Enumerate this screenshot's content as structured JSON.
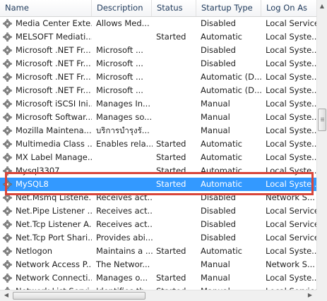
{
  "columns": {
    "name": "Name",
    "description": "Description",
    "status": "Status",
    "startup_type": "Startup Type",
    "log_on_as": "Log On As"
  },
  "rows": [
    {
      "name": "Media Center Exte...",
      "description": "Allows Med...",
      "status": "",
      "startup_type": "Disabled",
      "log_on_as": "Local Service"
    },
    {
      "name": "MELSOFT Mediati...",
      "description": "",
      "status": "Started",
      "startup_type": "Automatic",
      "log_on_as": "Local Syste..."
    },
    {
      "name": "Microsoft .NET Fr...",
      "description": "Microsoft ...",
      "status": "",
      "startup_type": "Disabled",
      "log_on_as": "Local Syste..."
    },
    {
      "name": "Microsoft .NET Fr...",
      "description": "Microsoft ...",
      "status": "",
      "startup_type": "Disabled",
      "log_on_as": "Local Syste..."
    },
    {
      "name": "Microsoft .NET Fr...",
      "description": "Microsoft ...",
      "status": "",
      "startup_type": "Automatic (D...",
      "log_on_as": "Local Syste..."
    },
    {
      "name": "Microsoft .NET Fr...",
      "description": "Microsoft ...",
      "status": "",
      "startup_type": "Automatic (D...",
      "log_on_as": "Local Syste..."
    },
    {
      "name": "Microsoft iSCSI Ini...",
      "description": "Manages In...",
      "status": "",
      "startup_type": "Manual",
      "log_on_as": "Local Syste..."
    },
    {
      "name": "Microsoft Softwar...",
      "description": "Manages so...",
      "status": "",
      "startup_type": "Manual",
      "log_on_as": "Local Syste..."
    },
    {
      "name": "Mozilla Maintena...",
      "description": "บริการบำรุงรั...",
      "status": "",
      "startup_type": "Manual",
      "log_on_as": "Local Syste..."
    },
    {
      "name": "Multimedia Class ...",
      "description": "Enables rela...",
      "status": "Started",
      "startup_type": "Automatic",
      "log_on_as": "Local Syste..."
    },
    {
      "name": "MX Label Manage...",
      "description": "",
      "status": "Started",
      "startup_type": "Automatic",
      "log_on_as": "Local Syste..."
    },
    {
      "name": "Mysql3307",
      "description": "",
      "status": "Started",
      "startup_type": "Automatic",
      "log_on_as": "Local Syste..."
    },
    {
      "name": "MySQL8",
      "description": "",
      "status": "Started",
      "startup_type": "Automatic",
      "log_on_as": "Local Syste...",
      "selected": true
    },
    {
      "name": "Net.Msmq Listene...",
      "description": "Receives act...",
      "status": "",
      "startup_type": "Disabled",
      "log_on_as": "Network S..."
    },
    {
      "name": "Net.Pipe Listener ...",
      "description": "Receives act...",
      "status": "",
      "startup_type": "Disabled",
      "log_on_as": "Local Service"
    },
    {
      "name": "Net.Tcp Listener A...",
      "description": "Receives act...",
      "status": "",
      "startup_type": "Disabled",
      "log_on_as": "Local Service"
    },
    {
      "name": "Net.Tcp Port Shari...",
      "description": "Provides abi...",
      "status": "",
      "startup_type": "Disabled",
      "log_on_as": "Local Service"
    },
    {
      "name": "Netlogon",
      "description": "Maintains a ...",
      "status": "Started",
      "startup_type": "Automatic",
      "log_on_as": "Local Syste..."
    },
    {
      "name": "Network Access P...",
      "description": "The Networ...",
      "status": "",
      "startup_type": "Manual",
      "log_on_as": "Network S..."
    },
    {
      "name": "Network Connecti...",
      "description": "Manages o...",
      "status": "Started",
      "startup_type": "Manual",
      "log_on_as": "Local Syste..."
    },
    {
      "name": "Network List Servi...",
      "description": "Identifies th...",
      "status": "Started",
      "startup_type": "Manual",
      "log_on_as": "Local Service"
    }
  ],
  "colors": {
    "selection": "#3399ff",
    "highlight_box": "#d9453a"
  },
  "icons": {
    "row_icon": "gear-icon"
  }
}
